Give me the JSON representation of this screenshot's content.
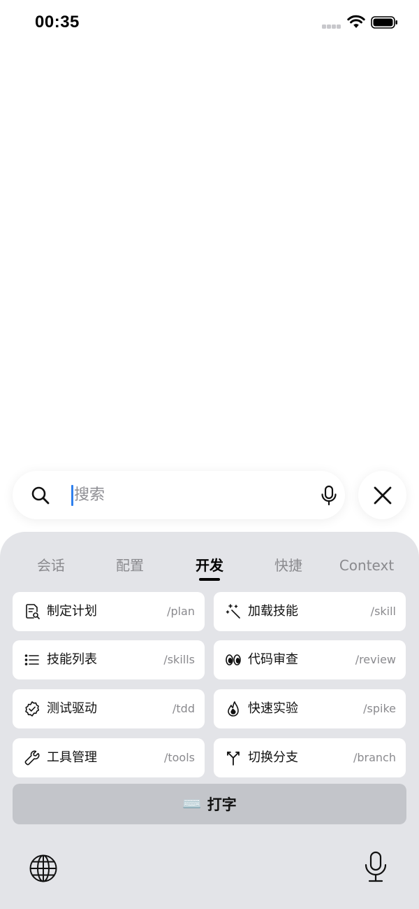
{
  "status_bar": {
    "time": "00:35"
  },
  "search": {
    "placeholder": "搜索",
    "value": ""
  },
  "tabs": [
    {
      "label": "会话",
      "active": false
    },
    {
      "label": "配置",
      "active": false
    },
    {
      "label": "开发",
      "active": true
    },
    {
      "label": "快捷",
      "active": false
    },
    {
      "label": "Context",
      "active": false
    }
  ],
  "commands": [
    {
      "label": "制定计划",
      "command": "/plan",
      "icon": "document-search-icon"
    },
    {
      "label": "加载技能",
      "command": "/skill",
      "icon": "magic-wand-icon"
    },
    {
      "label": "技能列表",
      "command": "/skills",
      "icon": "list-icon"
    },
    {
      "label": "代码审查",
      "command": "/review",
      "icon": "eyes-icon"
    },
    {
      "label": "测试驱动",
      "command": "/tdd",
      "icon": "badge-check-icon"
    },
    {
      "label": "快速实验",
      "command": "/spike",
      "icon": "flame-icon"
    },
    {
      "label": "工具管理",
      "command": "/tools",
      "icon": "wrench-icon"
    },
    {
      "label": "切换分支",
      "command": "/branch",
      "icon": "git-branch-icon"
    }
  ],
  "typing_button": {
    "icon": "⌨️",
    "label": "打字"
  }
}
